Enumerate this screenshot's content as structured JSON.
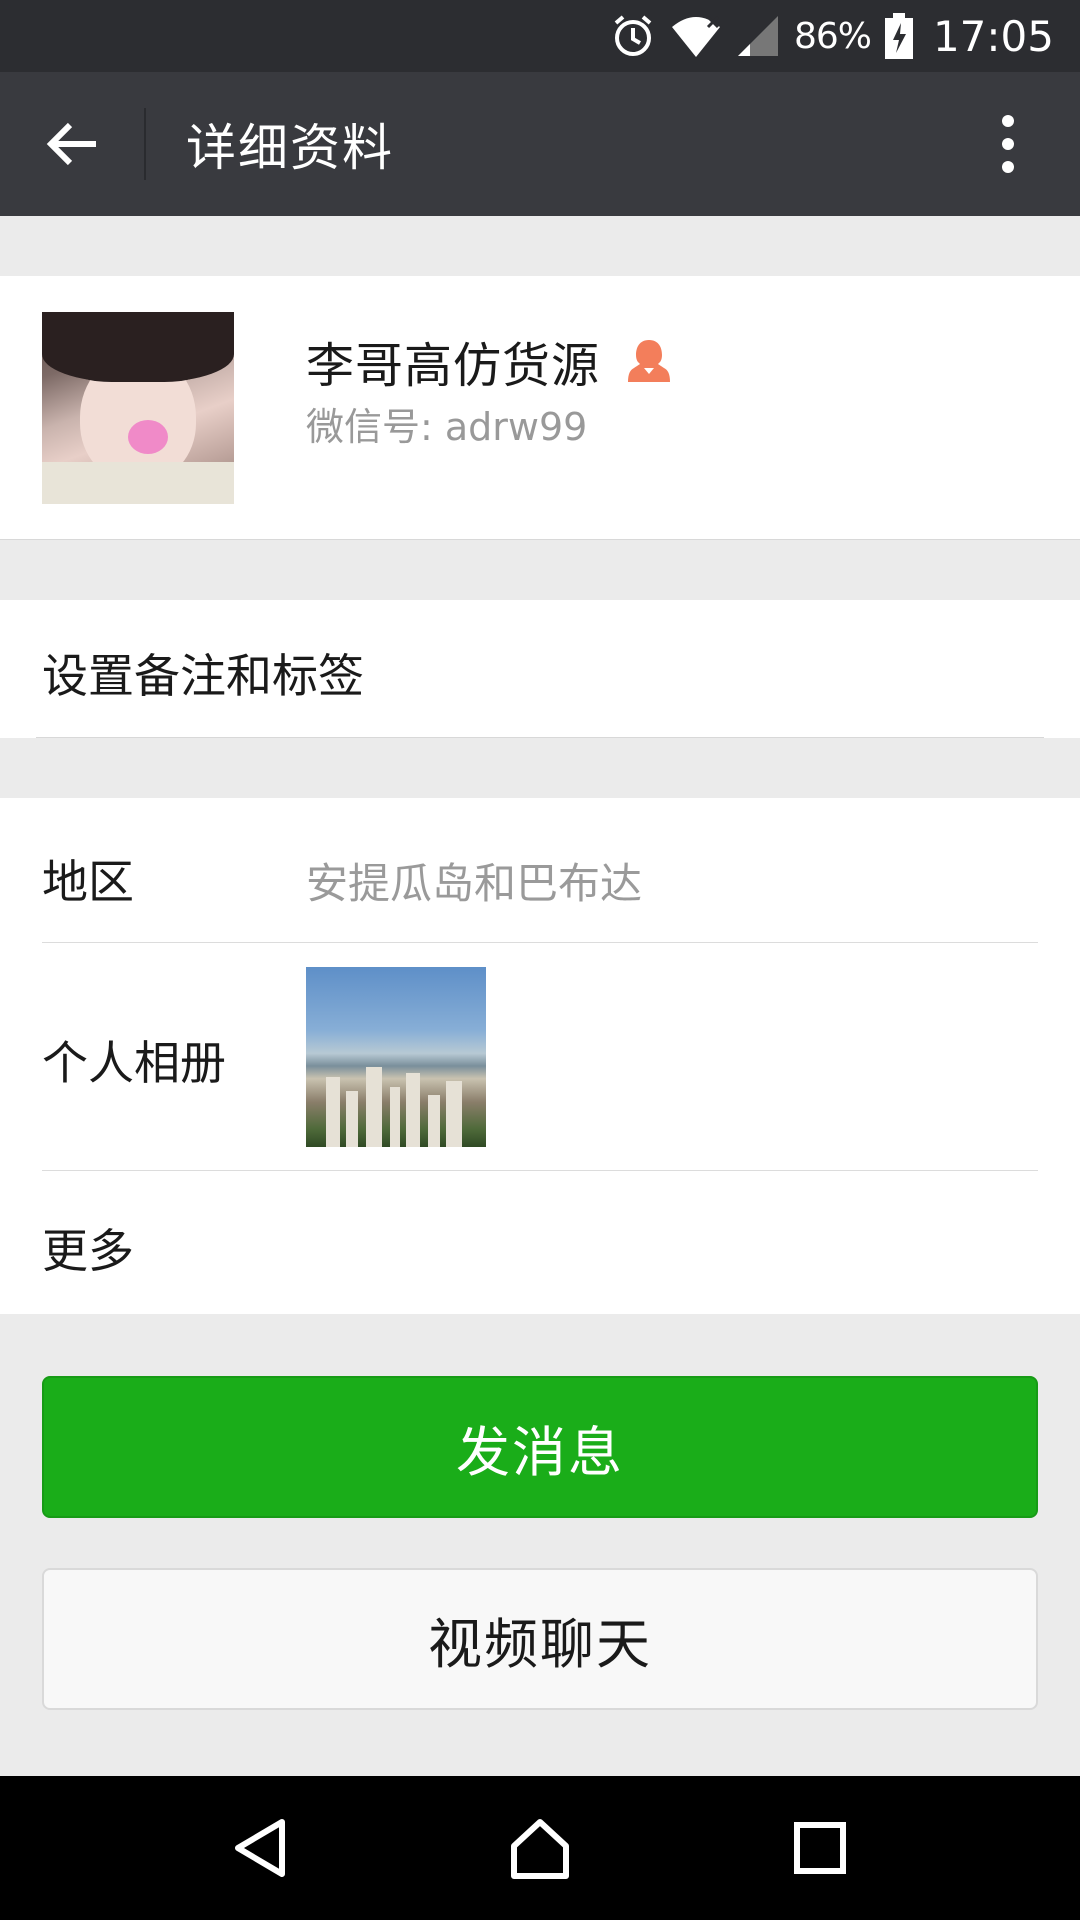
{
  "status_bar": {
    "battery_percent": "86%",
    "time": "17:05",
    "icons": [
      "alarm-icon",
      "wifi-icon",
      "cellular-signal-icon",
      "battery-charging-icon"
    ]
  },
  "header": {
    "title": "详细资料",
    "back_icon": "arrow-left-icon",
    "more_icon": "more-vertical-icon"
  },
  "profile": {
    "name": "李哥高仿货源",
    "wechat_id": "微信号: adrw99",
    "gender_icon": "female-icon",
    "gender_color": "#f37e5b"
  },
  "remark": {
    "label": "设置备注和标签"
  },
  "info": {
    "region_label": "地区",
    "region_value": "安提瓜岛和巴布达",
    "album_label": "个人相册",
    "more_label": "更多"
  },
  "actions": {
    "send_message": "发消息",
    "video_chat": "视频聊天",
    "send_color": "#1aad19"
  },
  "nav": {
    "icons": [
      "nav-back-icon",
      "nav-home-icon",
      "nav-recents-icon"
    ]
  }
}
